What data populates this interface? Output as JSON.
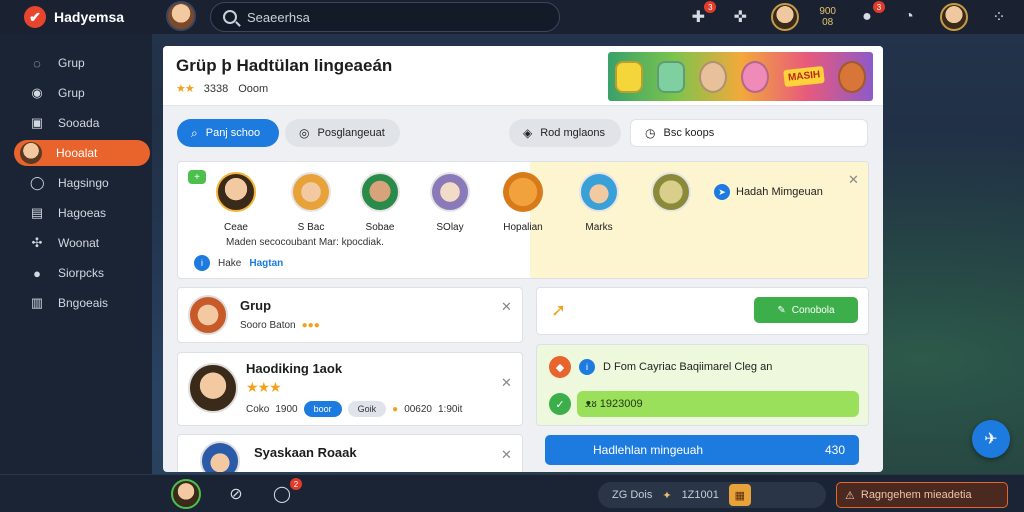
{
  "app": {
    "name": "Hadyemsa"
  },
  "search": {
    "placeholder": "Seaeerhsa"
  },
  "topbar": {
    "notif_badge": "3",
    "msg_badge": "3",
    "coins": "900",
    "coins_sub": "08"
  },
  "sidebar": {
    "items": [
      {
        "label": "Grup",
        "icon": "compass-icon"
      },
      {
        "label": "Grup",
        "icon": "globe-icon"
      },
      {
        "label": "Sooada",
        "icon": "calendar-icon"
      },
      {
        "label": "Hooalat",
        "icon": "avatar-icon",
        "active": true
      },
      {
        "label": "Hagsingo",
        "icon": "search-icon"
      },
      {
        "label": "Hagoeas",
        "icon": "image-icon"
      },
      {
        "label": "Woonat",
        "icon": "controller-icon"
      },
      {
        "label": "Siorpcks",
        "icon": "user-icon"
      },
      {
        "label": "Bngoeais",
        "icon": "bars-icon"
      }
    ]
  },
  "panel": {
    "title": "Grüp þ Hadtülan lingeaeán",
    "rating": "3338",
    "sub": "Ooom",
    "banner_label": "MASIH"
  },
  "filters": {
    "primary": "Panj schoo",
    "second": "Posglangeuat",
    "third": "Rod mglaons",
    "search": "Bsc koops"
  },
  "friends": {
    "add_label": "+",
    "names": [
      "Ceae",
      "S Bac",
      "Sobae",
      "SOlay",
      "Hopalian",
      "Marks"
    ],
    "description": "Maden secocoubant Mar: kpocdiak.",
    "link_prefix": "Hake",
    "link": "Hagtan",
    "right_title": "Hadah Mimgeuan"
  },
  "cards": [
    {
      "title": "Grup",
      "sub": "Sooro Baton"
    },
    {
      "title": "Haodiking 1aok",
      "sub_label": "Coko",
      "sub_value": "1900",
      "pill_blue": "boor",
      "pill_gray": "Goik",
      "coins": "00620",
      "extra": "1:90it"
    },
    {
      "title": "Syaskaan Roaak"
    }
  ],
  "right": {
    "button": "Conobola",
    "row1": "D Fom Cayriac Baqiimarel Cleg an",
    "bar": "ᴥᴕ 1923009",
    "blue_bar": "Hadlehlan mingeuah",
    "blue_bar_value": "430"
  },
  "bottom": {
    "status": "ZG Dois",
    "status_extra": "1Z1001",
    "alert": "Ragngehem mieadetia",
    "chat_badge": "2"
  },
  "colors": {
    "accent": "#e8642c",
    "primary": "#1d7be0",
    "success": "#3cae4a"
  }
}
